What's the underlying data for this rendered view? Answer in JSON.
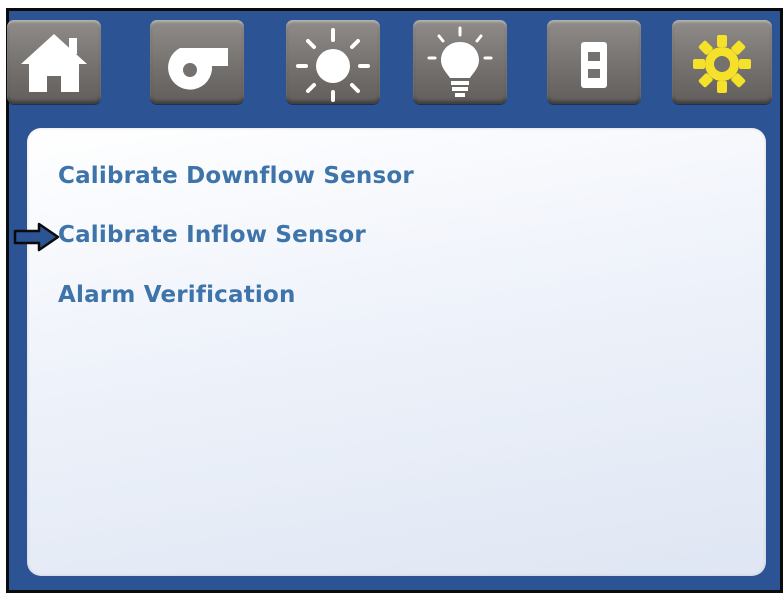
{
  "toolbar": {
    "tabs": [
      {
        "id": "home",
        "icon": "home-icon"
      },
      {
        "id": "blower",
        "icon": "blower-fan-icon"
      },
      {
        "id": "uv-light",
        "icon": "sun-icon"
      },
      {
        "id": "light",
        "icon": "light-bulb-icon"
      },
      {
        "id": "outlet",
        "icon": "power-outlet-icon"
      },
      {
        "id": "settings",
        "icon": "gear-icon",
        "icon_color": "#f6e12a"
      }
    ]
  },
  "menu": {
    "items": [
      {
        "label": "Calibrate Downflow Sensor"
      },
      {
        "label": "Calibrate Inflow Sensor"
      },
      {
        "label": "Alarm Verification"
      }
    ],
    "selected_index": 1,
    "item_color": "#3e74aa"
  },
  "colors": {
    "background": "#2c5394",
    "border": "#0b0b0b",
    "panel": "#eef2fa",
    "pointer": "#2c5394"
  }
}
